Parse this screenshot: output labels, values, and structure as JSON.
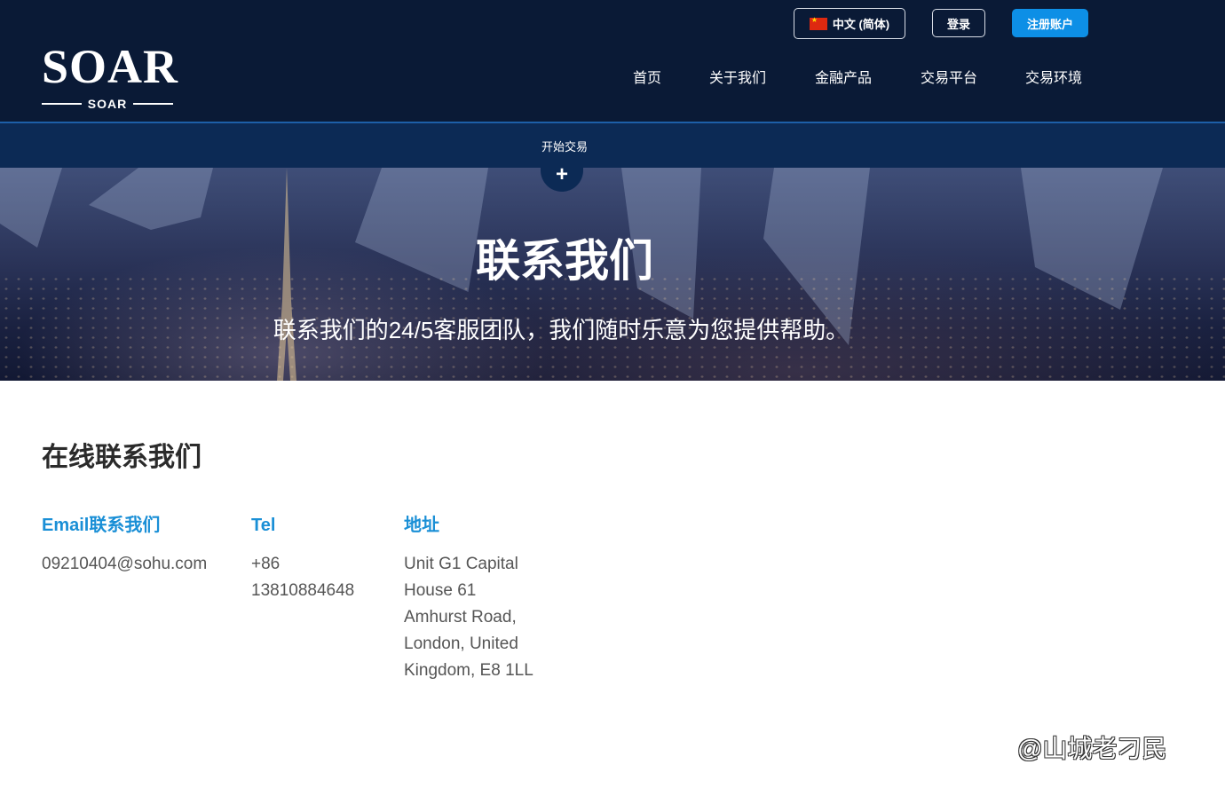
{
  "header": {
    "logo_main": "SOAR",
    "logo_sub": "SOAR",
    "lang_label": "中文 (简体)",
    "login_label": "登录",
    "register_label": "注册账户",
    "nav": [
      "首页",
      "关于我们",
      "金融产品",
      "交易平台",
      "交易环境"
    ]
  },
  "subbar": {
    "label": "开始交易",
    "plus": "+"
  },
  "hero": {
    "title": "联系我们",
    "subtitle": "联系我们的24/5客服团队，我们随时乐意为您提供帮助。"
  },
  "contact": {
    "section_title": "在线联系我们",
    "email": {
      "heading": "Email联系我们",
      "value": "09210404@sohu.com"
    },
    "tel": {
      "heading": "Tel",
      "value": "+86 13810884648"
    },
    "address": {
      "heading": "地址",
      "value": "Unit G1 Capital House 61 Amhurst Road, London, United Kingdom, E8 1LL"
    }
  },
  "watermark": "@山城老刁民",
  "colors": {
    "header_bg": "#0a1a36",
    "subbar_bg": "#0c2a55",
    "accent": "#0d8fe6",
    "heading_blue": "#1a8fd6"
  }
}
